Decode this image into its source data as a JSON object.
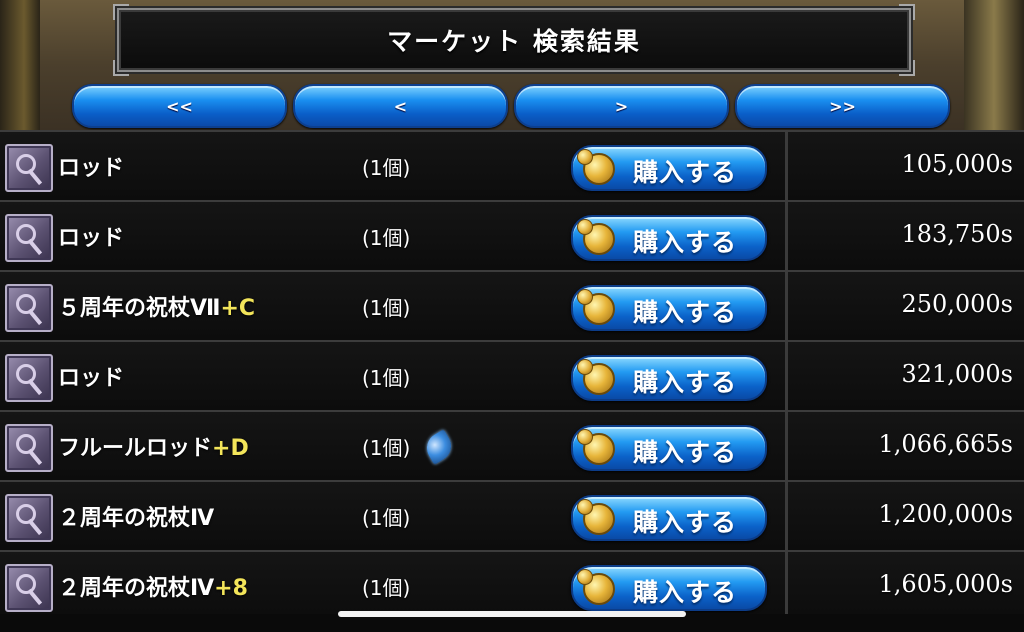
{
  "header": {
    "title": "マーケット 検索結果"
  },
  "pager": {
    "first": "<<",
    "prev": "<",
    "next": ">",
    "last": ">>"
  },
  "buy_label": "購入する",
  "items": [
    {
      "name": "ロッド",
      "plus": "",
      "qty": "(1個)",
      "price": "105,000s",
      "bound": false
    },
    {
      "name": "ロッド",
      "plus": "",
      "qty": "(1個)",
      "price": "183,750s",
      "bound": false
    },
    {
      "name": "５周年の祝杖Ⅶ",
      "plus": "+C",
      "qty": "(1個)",
      "price": "250,000s",
      "bound": false
    },
    {
      "name": "ロッド",
      "plus": "",
      "qty": "(1個)",
      "price": "321,000s",
      "bound": false
    },
    {
      "name": "フルールロッド",
      "plus": "+D",
      "qty": "(1個)",
      "price": "1,066,665s",
      "bound": true
    },
    {
      "name": "２周年の祝杖Ⅳ",
      "plus": "",
      "qty": "(1個)",
      "price": "1,200,000s",
      "bound": false
    },
    {
      "name": "２周年の祝杖Ⅳ",
      "plus": "+8",
      "qty": "(1個)",
      "price": "1,605,000s",
      "bound": false
    }
  ]
}
